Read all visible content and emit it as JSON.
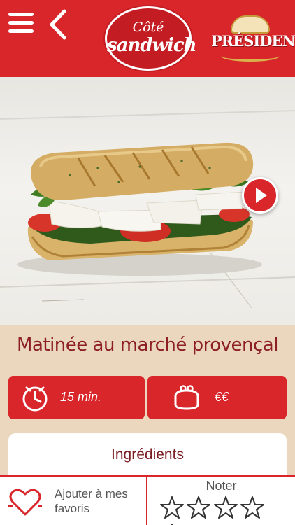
{
  "header": {
    "logo_line1": "Côté",
    "logo_line2": "sandwich",
    "brand": "PRÉSIDENT"
  },
  "recipe": {
    "title": "Matinée au marché provençal",
    "time": "15 min.",
    "cost": "€€",
    "ingredients_tab": "Ingrédients"
  },
  "bottom": {
    "favorite_label": "Ajouter à mes favoris",
    "rate_label": "Noter",
    "stars": [
      0,
      0,
      0,
      0,
      0
    ]
  },
  "icons": {
    "menu": "hamburger-menu-icon",
    "back": "chevron-left-icon",
    "next": "play-arrow-icon",
    "time": "clock-icon",
    "cost": "purse-icon",
    "favorite": "heart-icon",
    "star": "star-outline-icon"
  },
  "colors": {
    "brand_red": "#d8262b",
    "title_red": "#8c1e24",
    "background": "#ead7bd"
  }
}
